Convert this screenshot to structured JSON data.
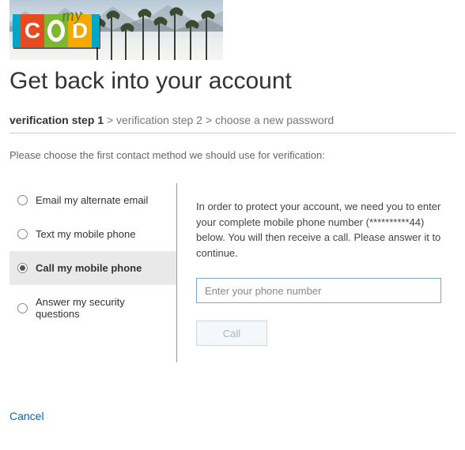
{
  "logo": {
    "prefix": "my",
    "letters": [
      "C",
      "O",
      "D"
    ]
  },
  "title": "Get back into your account",
  "breadcrumb": {
    "step1": "verification step 1",
    "sep": ">",
    "step2": "verification step 2",
    "step3": "choose a new password"
  },
  "instruction": "Please choose the first contact method we should use for verification:",
  "options": {
    "email": "Email my alternate email",
    "text": "Text my mobile phone",
    "call": "Call my mobile phone",
    "questions": "Answer my security questions"
  },
  "right": {
    "blurb": "In order to protect your account, we need you to enter your complete mobile phone number (**********44) below. You will then receive a call. Please answer it to continue.",
    "placeholder": "Enter your phone number",
    "call_button": "Call"
  },
  "cancel": "Cancel"
}
